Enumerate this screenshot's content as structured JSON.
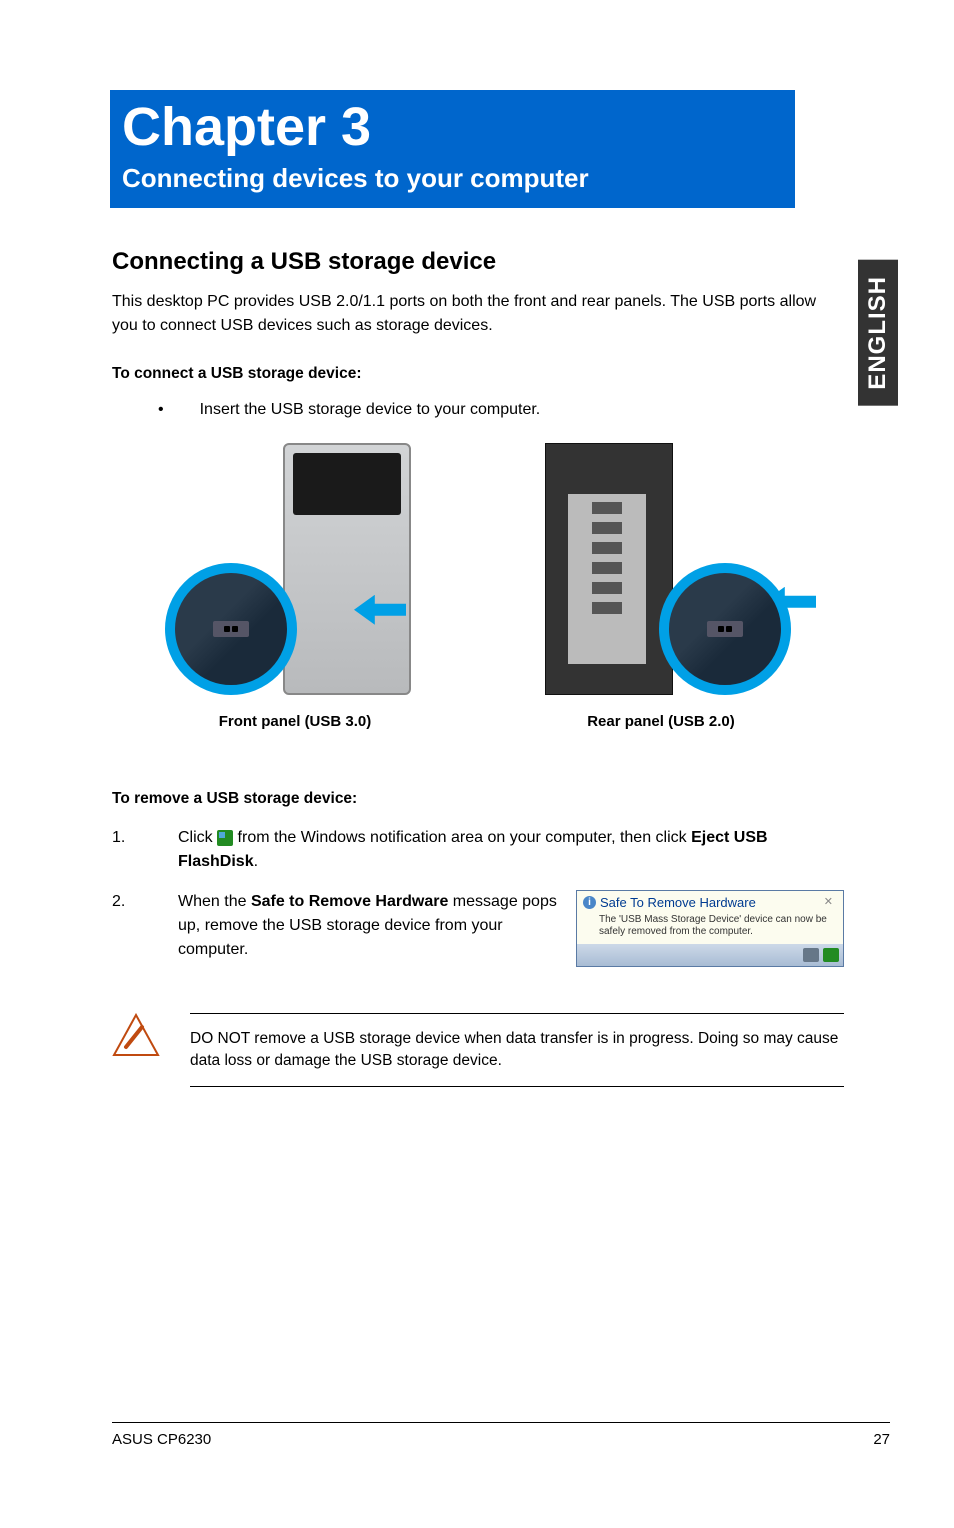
{
  "language_tab": "ENGLISH",
  "chapter": {
    "number": "Chapter 3",
    "subtitle": "Connecting devices to your computer"
  },
  "section": {
    "heading": "Connecting a USB storage device",
    "intro": "This desktop PC provides USB 2.0/1.1 ports on both the front and rear panels. The USB ports allow you to connect USB devices such as storage devices.",
    "connect_heading": "To connect a USB storage device:",
    "connect_bullet": "Insert the USB storage device to your computer.",
    "front_caption": "Front panel (USB 3.0)",
    "rear_caption": "Rear panel (USB 2.0)"
  },
  "remove": {
    "heading": "To remove a USB storage device:",
    "step1_num": "1.",
    "step1_pre": "Click ",
    "step1_mid": " from the Windows notification area on your computer, then click ",
    "step1_bold": "Eject USB FlashDisk",
    "step1_end": ".",
    "step2_num": "2.",
    "step2_pre": "When the ",
    "step2_bold": "Safe to Remove Hardware",
    "step2_post": " message pops up, remove the USB storage device from your computer."
  },
  "notification": {
    "title": "Safe To Remove Hardware",
    "body": "The 'USB Mass Storage Device' device can now be safely removed from the computer."
  },
  "warning": "DO NOT remove a USB storage device when data transfer is in progress. Doing so may cause data loss or damage the USB storage device.",
  "footer": {
    "left": "ASUS CP6230",
    "right": "27"
  }
}
